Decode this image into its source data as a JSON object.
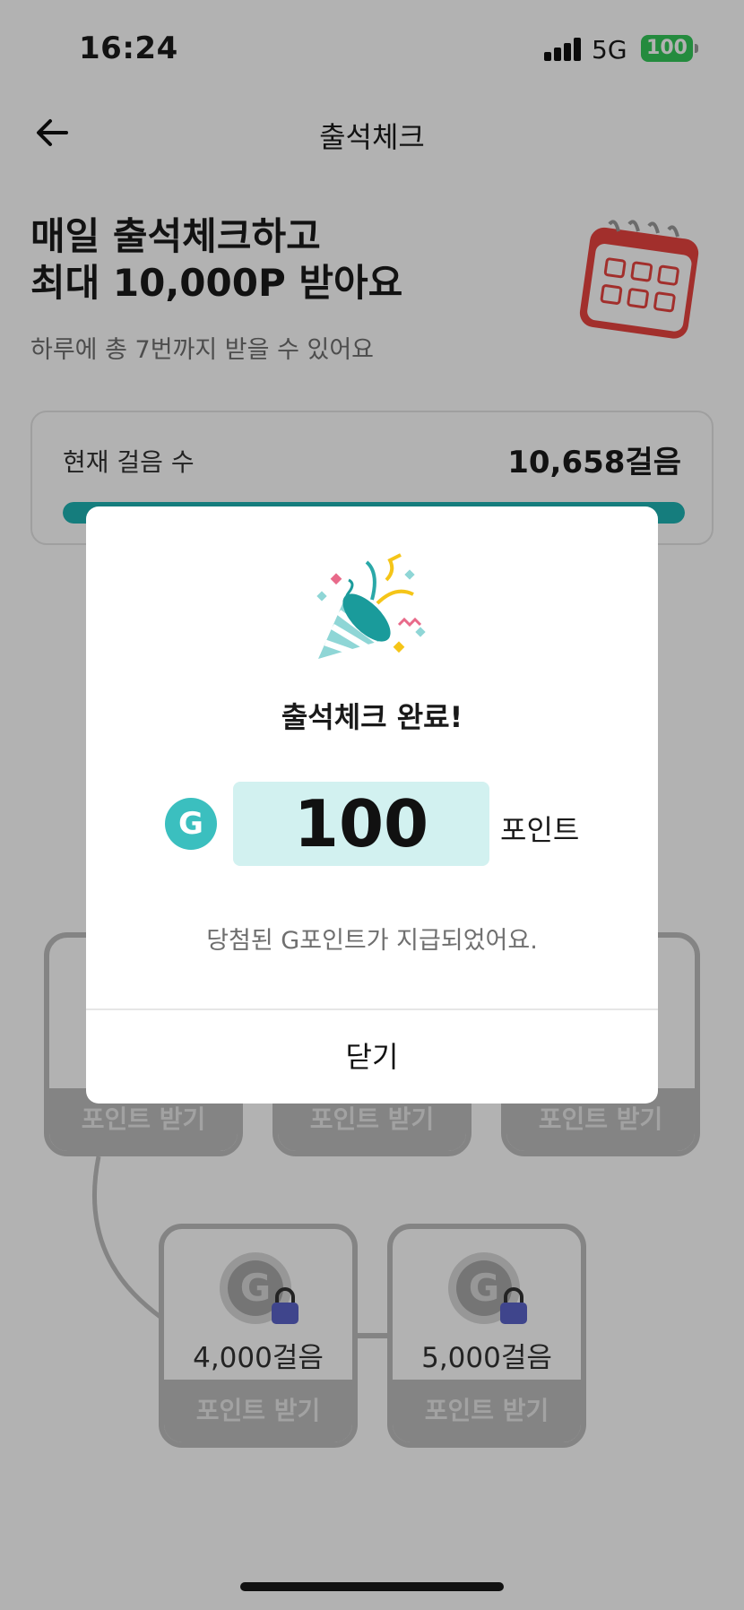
{
  "status_bar": {
    "time": "16:24",
    "network": "5G",
    "battery": "100"
  },
  "header": {
    "title": "출석체크",
    "back_icon": "arrow-left-icon"
  },
  "hero": {
    "title_line1": "매일 출석체크하고",
    "title_line2": "최대 10,000P 받아요",
    "subtitle": "하루에 총 7번까지 받을 수 있어요",
    "icon": "calendar-icon"
  },
  "steps_card": {
    "label": "현재 걸음 수",
    "value": "10,658걸음",
    "progress": 1.0,
    "accent": "#1fb3b3"
  },
  "rewards": {
    "button_label": "포인트 받기",
    "tiles": [
      {
        "steps": "4,000걸음"
      },
      {
        "steps": "5,000걸음"
      }
    ]
  },
  "modal": {
    "icon": "party-popper-icon",
    "title": "출석체크 완료!",
    "coin_letter": "G",
    "points": "100",
    "points_unit": "포인트",
    "description": "당첨된 G포인트가 지급되었어요.",
    "close_label": "닫기",
    "accent": "#3bbfbf"
  }
}
